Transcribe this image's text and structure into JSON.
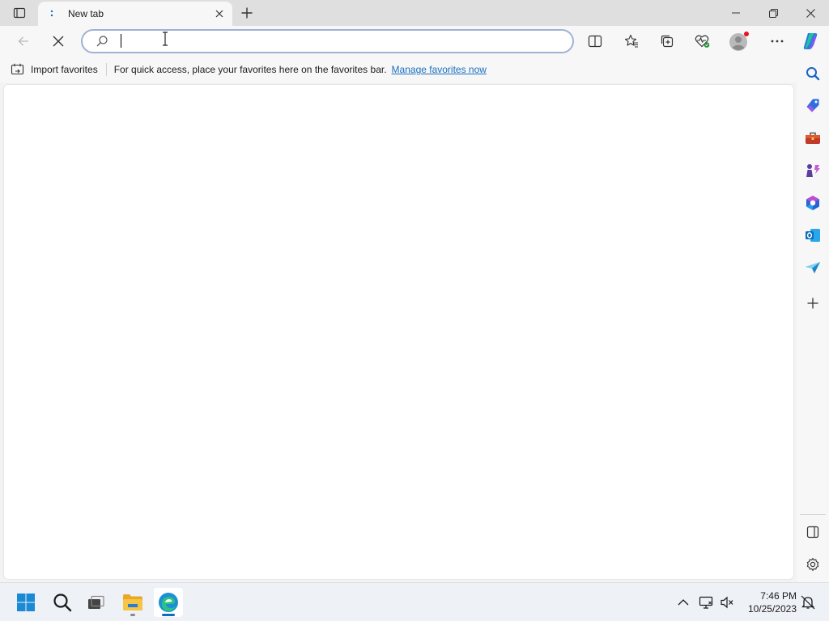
{
  "browser": {
    "tab": {
      "title": "New tab"
    },
    "addressbar": {
      "value": "",
      "placeholder": ""
    },
    "favorites_bar": {
      "import_label": "Import favorites",
      "message": "For quick access, place your favorites here on the favorites bar.",
      "manage_link": "Manage favorites now"
    }
  },
  "icons": {
    "titlebar": [
      "tab-actions-icon",
      "tab-favicon-icon",
      "close-tab-icon",
      "new-tab-icon",
      "minimize-icon",
      "restore-icon",
      "close-window-icon"
    ],
    "toolbar": [
      "back-icon",
      "stop-loading-icon",
      "search-icon",
      "split-screen-icon",
      "favorites-icon",
      "collections-icon",
      "browser-essentials-icon",
      "profile-icon",
      "more-icon",
      "copilot-icon"
    ],
    "sidebar": [
      "search-icon",
      "shopping-icon",
      "tools-icon",
      "games-icon",
      "microsoft-365-icon",
      "outlook-icon",
      "drop-icon",
      "add-icon",
      "hide-sidebar-icon",
      "settings-icon"
    ],
    "taskbar": [
      "start-icon",
      "search-icon",
      "task-view-icon",
      "file-explorer-icon",
      "edge-icon"
    ],
    "tray": [
      "show-hidden-icons-icon",
      "network-icon",
      "volume-muted-icon",
      "notifications-icon"
    ]
  },
  "taskbar": {
    "clock": {
      "time": "7:46 PM",
      "date": "10/25/2023"
    }
  },
  "colors": {
    "accent": "#0f6cbd",
    "link": "#1a6fbf",
    "profile_badge": "#e81123"
  }
}
